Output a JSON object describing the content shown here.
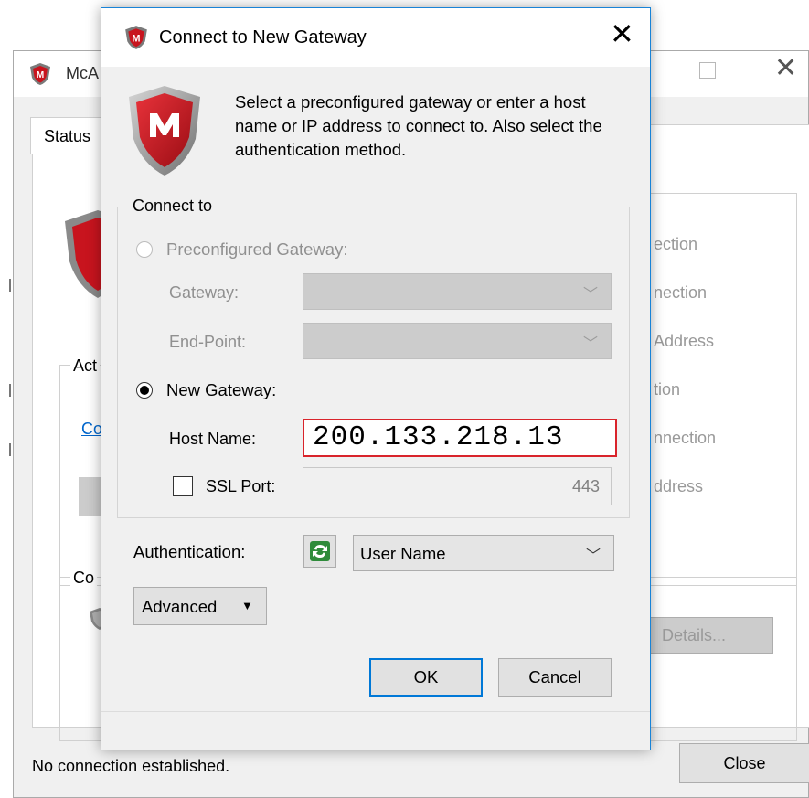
{
  "background_window": {
    "title": "McA",
    "tab": "Status",
    "activity_legend": "Act",
    "activity_link": "Co",
    "connection_legend": "Co",
    "right_texts": [
      "ection",
      "nection",
      "Address",
      "tion",
      "nnection",
      "ddress"
    ],
    "details_button": "Details...",
    "status_text": "No connection established.",
    "close_button": "Close"
  },
  "dialog": {
    "title": "Connect to New Gateway",
    "description": "Select a preconfigured gateway or enter a host name or IP address to connect to. Also select the authentication method.",
    "connect_to": {
      "legend": "Connect to",
      "preconfigured_label": "Preconfigured Gateway:",
      "gateway_label": "Gateway:",
      "endpoint_label": "End-Point:",
      "new_gateway_label": "New Gateway:",
      "host_name_label": "Host Name:",
      "host_name_value": "200.133.218.13",
      "ssl_port_label": "SSL Port:",
      "ssl_port_value": "443",
      "selected": "new_gateway",
      "ssl_checked": false
    },
    "authentication": {
      "label": "Authentication:",
      "value": "User Name"
    },
    "advanced_label": "Advanced",
    "ok_label": "OK",
    "cancel_label": "Cancel"
  },
  "colors": {
    "accent": "#0078d7",
    "dialog_border": "#1883d7",
    "highlight_box": "#d9242b",
    "shield_red": "#c8141e"
  },
  "icons": {
    "title_icon": "mcafee-shield-icon",
    "big_icon": "mcafee-logo-shield-icon",
    "refresh_icon": "refresh-icon"
  }
}
